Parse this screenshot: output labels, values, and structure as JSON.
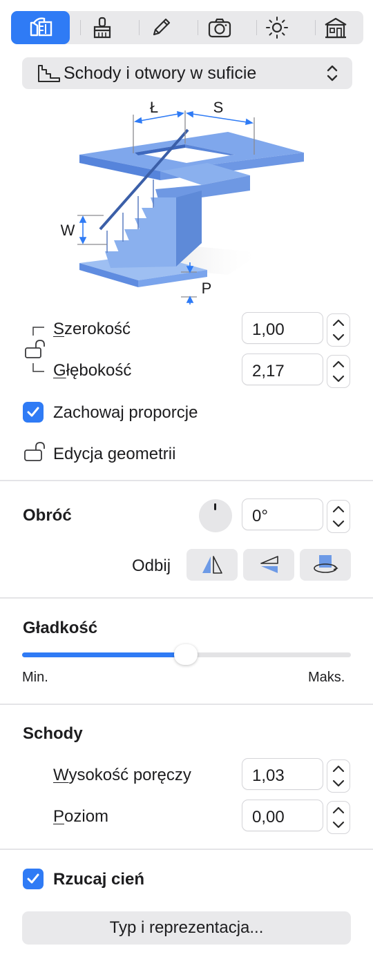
{
  "toolbar": {
    "tabs": [
      {
        "icon": "object-modify-icon",
        "active": true
      },
      {
        "icon": "paint-icon",
        "active": false
      },
      {
        "icon": "pencil-icon",
        "active": false
      },
      {
        "icon": "camera-icon",
        "active": false
      },
      {
        "icon": "light-icon",
        "active": false
      },
      {
        "icon": "house-icon",
        "active": false
      }
    ]
  },
  "popup": {
    "label": "Schody i otwory w suficie"
  },
  "diagram": {
    "label_l": "Ł",
    "label_s": "S",
    "label_w": "W",
    "label_p": "P"
  },
  "dimensions": {
    "width_first": "S",
    "width_rest": "zerokość",
    "width_value": "1,00",
    "depth_first": "G",
    "depth_rest": "łębokość",
    "depth_value": "2,17",
    "keep_proportions_label": "Zachowaj proporcje",
    "keep_proportions_checked": true,
    "edit_geometry_label": "Edycja geometrii"
  },
  "rotate": {
    "title": "Obróć",
    "angle_value": "0°",
    "mirror_label": "Odbij"
  },
  "smoothness": {
    "title": "Gładkość",
    "min_label": "Min.",
    "max_label": "Maks.",
    "level_percent": 50
  },
  "stairs": {
    "title": "Schody",
    "rail_height_first": "W",
    "rail_height_rest": "ysokość poręczy",
    "rail_height_value": "1,03",
    "level_first": "P",
    "level_rest": "oziom",
    "level_value": "0,00"
  },
  "shadow": {
    "label": "Rzucaj cień",
    "checked": true
  },
  "type_button": {
    "label": "Typ i reprezentacja..."
  },
  "colors": {
    "accent": "#2f7bf5",
    "stair_blue": "#6d9ae6",
    "stair_dark": "#4a75c8"
  }
}
